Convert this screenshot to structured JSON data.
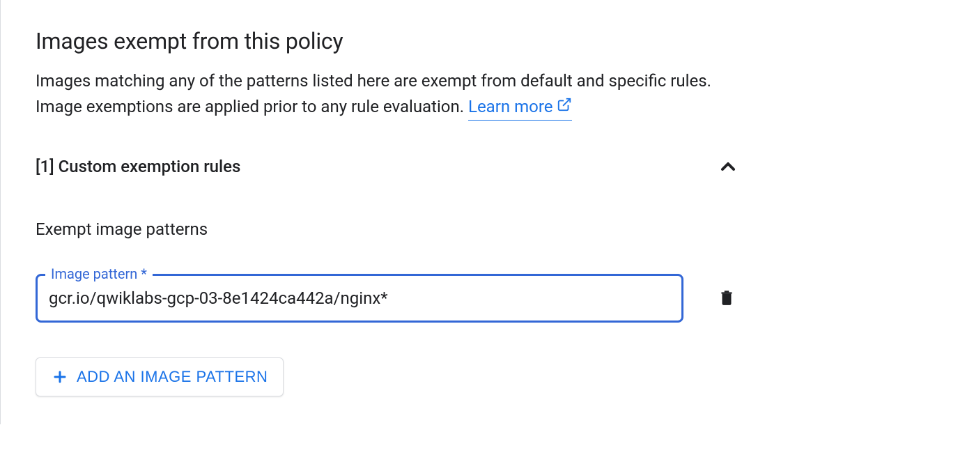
{
  "section": {
    "title": "Images exempt from this policy",
    "description": "Images matching any of the patterns listed here are exempt from default and specific rules. Image exemptions are applied prior to any rule evaluation. ",
    "learn_more": "Learn more"
  },
  "accordion": {
    "title": "[1] Custom exemption rules"
  },
  "subsection": {
    "title": "Exempt image patterns"
  },
  "input": {
    "label": "Image pattern",
    "required": "*",
    "value": "gcr.io/qwiklabs-gcp-03-8e1424ca442a/nginx*"
  },
  "add_button": {
    "label": "ADD AN IMAGE PATTERN"
  }
}
